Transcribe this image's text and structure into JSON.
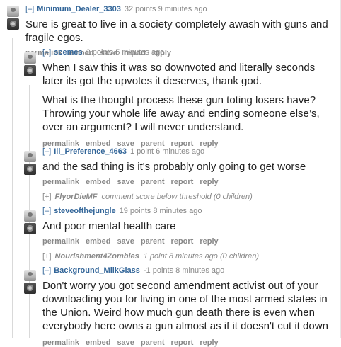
{
  "comments": [
    {
      "toggle": "[–]",
      "author": "Minimum_Dealer_3303",
      "score": "32 points",
      "time": "9 minutes ago",
      "paragraphs": [
        "Sure is great to live in a society completely awash with guns and fragile egos."
      ],
      "buttons": [
        "permalink",
        "embed",
        "save",
        "report",
        "reply"
      ]
    },
    {
      "toggle": "[–]",
      "author": "scemes",
      "score": "2 points",
      "time": "5 minutes ago",
      "paragraphs": [
        "When I saw this it was so downvoted and literally seconds later its got the upvotes it deserves, thank god.",
        "What is the thought process these gun toting losers have? Throwing your whole life away and ending someone else’s, over an argument? I will never understand."
      ],
      "buttons": [
        "permalink",
        "embed",
        "save",
        "parent",
        "report",
        "reply"
      ]
    },
    {
      "toggle": "[–]",
      "author": "Ill_Preference_4663",
      "score": "1 point",
      "time": "6 minutes ago",
      "paragraphs": [
        "and the sad thing is it's probably only going to get worse"
      ],
      "buttons": [
        "permalink",
        "embed",
        "save",
        "parent",
        "report",
        "reply"
      ]
    },
    {
      "toggle": "[–]",
      "author": "steveofthejungle",
      "score": "19 points",
      "time": "8 minutes ago",
      "paragraphs": [
        "And poor mental health care"
      ],
      "buttons": [
        "permalink",
        "embed",
        "save",
        "parent",
        "report",
        "reply"
      ]
    },
    {
      "toggle": "[–]",
      "author": "Background_MilkGlass",
      "score": "-1 points",
      "time": "8 minutes ago",
      "paragraphs": [
        "Don't worry you got second amendment activist out of your downloading you for living in one of the most armed states in the Union. Weird how much gun death there is even when everybody here owns a gun almost as if it doesn't cut it down"
      ],
      "buttons": [
        "permalink",
        "embed",
        "save",
        "parent",
        "report",
        "reply"
      ]
    }
  ],
  "collapsed": [
    {
      "toggle": "[+]",
      "author": "FlyorDieMF",
      "text": "comment score below threshold",
      "children": "(0 children)"
    },
    {
      "toggle": "[+]",
      "author": "Nourishment4Zombies",
      "text": "1 point 8 minutes ago",
      "children": "(0 children)"
    }
  ]
}
